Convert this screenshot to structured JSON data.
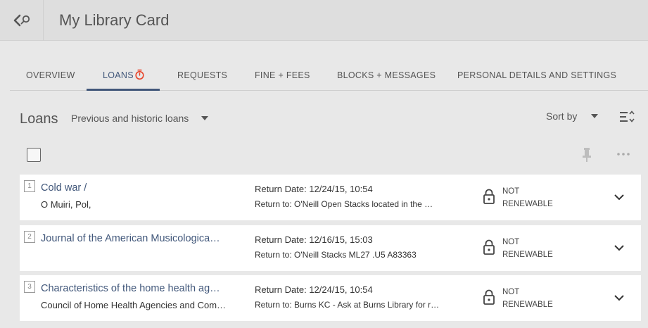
{
  "header": {
    "page_title": "My Library Card",
    "back_icon": "back-search-icon"
  },
  "tabs": [
    {
      "label": "OVERVIEW"
    },
    {
      "label": "LOANS"
    },
    {
      "label": "REQUESTS"
    },
    {
      "label": "FINE + FEES"
    },
    {
      "label": "BLOCKS + MESSAGES"
    },
    {
      "label": "PERSONAL DETAILS AND SETTINGS"
    }
  ],
  "active_tab": "LOANS",
  "loans": {
    "title": "Loans",
    "filter_label": "Previous and historic loans",
    "sort_label": "Sort by"
  },
  "items": [
    {
      "number": "1",
      "title": "Cold war /",
      "author": "O Muiri, Pol,",
      "return_date": "Return Date: 12/24/15, 10:54",
      "return_to": "Return to: O'Neill Open Stacks located in the …",
      "status": "NOT RENEWABLE"
    },
    {
      "number": "2",
      "title": "Journal of the American Musicologica…",
      "author": "",
      "return_date": "Return Date: 12/16/15, 15:03",
      "return_to": "Return to: O'Neill Stacks ML27 .U5 A83363",
      "status": "NOT RENEWABLE"
    },
    {
      "number": "3",
      "title": "Characteristics of the home health ag…",
      "author": "Council of Home Health Agencies and Com…",
      "return_date": "Return Date: 12/24/15, 10:54",
      "return_to": "Return to: Burns KC - Ask at Burns Library for r…",
      "status": "NOT RENEWABLE"
    }
  ],
  "colors": {
    "accent": "#41577a",
    "alert": "#e8442a",
    "background": "#e8e8e8"
  }
}
